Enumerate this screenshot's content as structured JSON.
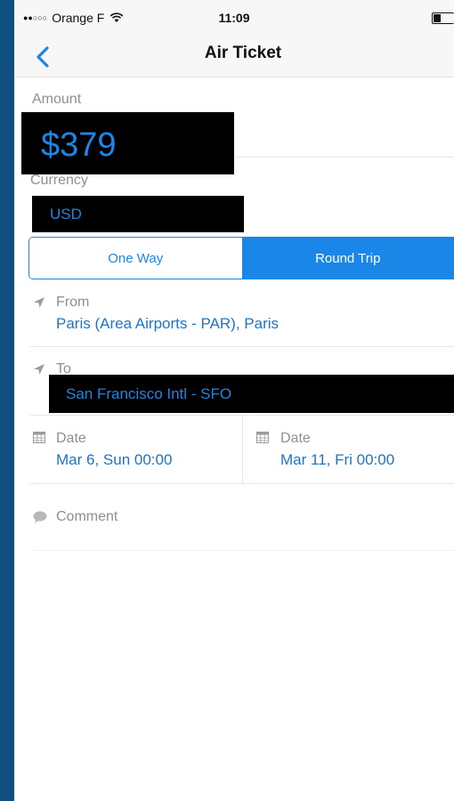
{
  "status_bar": {
    "signal": "●●○○○",
    "carrier": "Orange F",
    "time": "11:09"
  },
  "nav": {
    "title": "Air Ticket"
  },
  "amount": {
    "label": "Amount",
    "value": "$379"
  },
  "currency": {
    "label": "Currency",
    "value": "USD"
  },
  "trip_type": {
    "options": [
      "One Way",
      "Round Trip"
    ],
    "selected": "Round Trip"
  },
  "from": {
    "label": "From",
    "value": "Paris (Area Airports - PAR), Paris"
  },
  "to": {
    "label": "To",
    "value": "San Francisco Intl - SFO"
  },
  "dates": [
    {
      "label": "Date",
      "value": "Mar 6, Sun 00:00"
    },
    {
      "label": "Date",
      "value": "Mar 11, Fri 00:00"
    }
  ],
  "comment": {
    "label": "Comment"
  },
  "colors": {
    "accent": "#1a87e8",
    "background": "#0f4f82"
  }
}
